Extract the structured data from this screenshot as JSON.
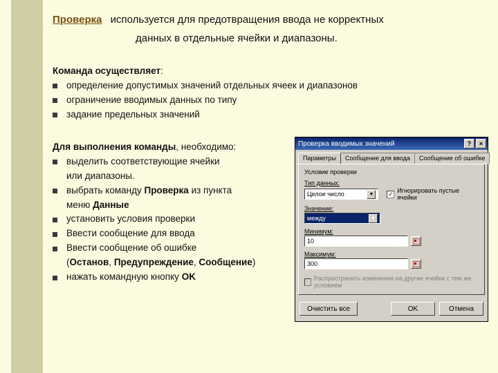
{
  "title": {
    "link": "Проверка",
    "line1_rest": "используется для предотвращения ввода не корректных",
    "line2": "данных в отдельные ячейки и диапазоны."
  },
  "section1": {
    "heading_bold": "Команда осуществляет",
    "heading_tail": ":",
    "items": [
      "определение допустимых значений отдельных ячеек и  диапазонов",
      "ограничение вводимых данных по типу",
      "задание предельных значений"
    ]
  },
  "section2": {
    "heading_bold": "Для выполнения команды",
    "heading_tail": ", необходимо:",
    "items": [
      {
        "text": "выделить соответствующие ячейки",
        "extra": "или диапазоны."
      },
      {
        "prefix": "выбрать команду ",
        "bold1": "Проверка",
        "mid": " из пункта",
        "extra_prefix": "меню ",
        "extra_bold": "Данные"
      },
      {
        "text": "установить условия проверки"
      },
      {
        "text": "Ввести сообщение для ввода"
      },
      {
        "text": "Ввести сообщение об ошибке",
        "extra_paren": true,
        "p1": "Останов",
        "pc1": ", ",
        "p2": "Предупреждение",
        "pc2": ", ",
        "p3": "Сообщение"
      },
      {
        "prefix": "нажать командную кнопку ",
        "bold1": "OK"
      }
    ]
  },
  "dialog": {
    "title": "Проверка вводимых значений",
    "tabs": [
      "Параметры",
      "Сообщение для ввода",
      "Сообщение об ошибке"
    ],
    "group_label": "Условие проверки",
    "type_label": "Тип данных:",
    "type_value": "Целое число",
    "ignore_empty": "Игнорировать пустые ячейки",
    "value_label": "Значение:",
    "value_value": "между",
    "min_label": "Минимум:",
    "min_value": "10",
    "max_label": "Максимум:",
    "max_value": "300",
    "spread_label": "Распространить изменения на другие ячейки с тем же условием",
    "clear_btn": "Очистить все",
    "ok_btn": "OK",
    "cancel_btn": "Отмена"
  }
}
